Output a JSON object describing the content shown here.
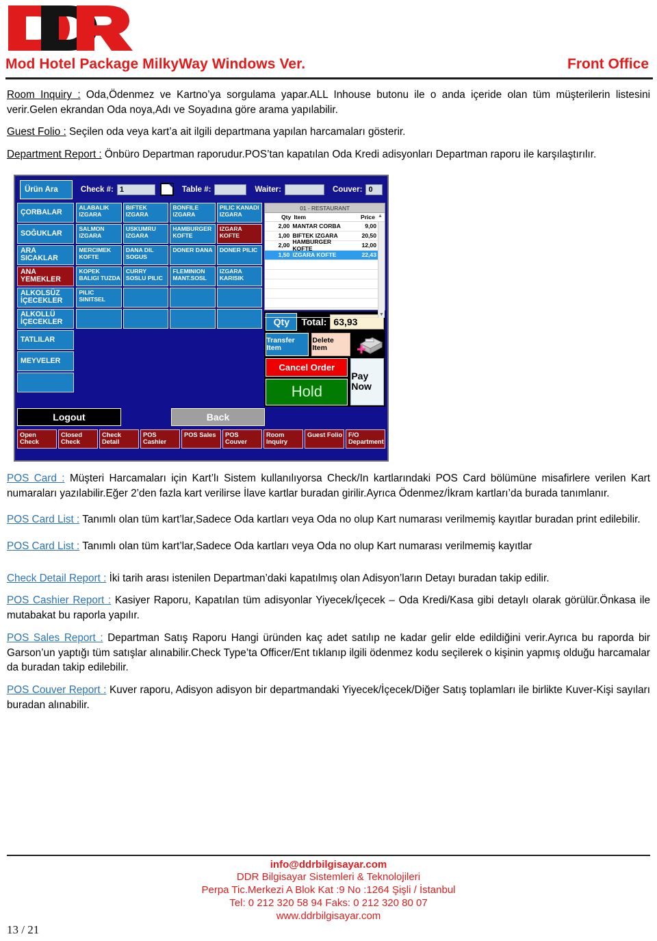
{
  "header": {
    "logo_text": "DDR",
    "title_left": "Mod Hotel Package MilkyWay Windows Ver.",
    "title_right": "Front Office"
  },
  "sections": [
    {
      "label": "Room Inquiry :",
      "label_color": "black",
      "body": "Oda,Ödenmez ve Kartno’ya sorgulama yapar.ALL Inhouse butonu ile o anda içeride olan tüm müşterilerin listesini verir.Gelen ekrandan Oda noya,Adı ve Soyadına göre arama yapılabilir."
    },
    {
      "label": "Guest Folio :",
      "label_color": "black",
      "body": "Seçilen oda veya kart’a ait ilgili departmana yapılan harcamaları gösterir."
    },
    {
      "label": "Department Report :",
      "label_color": "black",
      "body": "Önbüro Departman raporudur.POS’tan kapatılan Oda Kredi adisyonları Departman raporu ile karşılaştırılır."
    },
    {
      "label": "POS Card :",
      "label_color": "blue",
      "body": "Müşteri Harcamaları için Kart’lı Sistem kullanılıyorsa Check/In kartlarındaki POS Card bölümüne misafirlere verilen Kart numaraları yazılabilir.Eğer 2’den fazla kart verilirse İlave kartlar buradan girilir.Ayrıca Ödenmez/İkram kartları’da burada tanımlanır."
    },
    {
      "label": "POS Card List :",
      "label_color": "blue",
      "body": "Tanımlı olan tüm kart’lar,Sadece Oda kartları veya Oda no olup Kart numarası verilmemiş kayıtlar buradan print edilebilir."
    },
    {
      "label": "POS Card List :",
      "label_color": "blue",
      "body": "Tanımlı olan tüm kart’lar,Sadece Oda kartları veya Oda no olup Kart numarası verilmemiş kayıtlar"
    },
    {
      "label": "Check Detail Report :",
      "label_color": "blue",
      "body": "İki tarih arası istenilen Departman’daki kapatılmış olan Adisyon’ların Detayı buradan takip edilir."
    },
    {
      "label": "POS Cashier Report :",
      "label_color": "blue",
      "body": "Kasiyer Raporu, Kapatılan tüm adisyonlar Yiyecek/İçecek – Oda Kredi/Kasa gibi detaylı olarak görülür.Önkasa ile mutabakat bu raporla yapılır."
    },
    {
      "label": "POS Sales Report :",
      "label_color": "blue",
      "body": "Departman Satış Raporu Hangi üründen kaç adet satılıp ne kadar gelir elde edildiğini verir.Ayrıca bu raporda bir Garson’un yaptığı tüm satışlar alınabilir.Check Type’ta Officer/Ent tıklanıp ilgili ödenmez kodu seçilerek o kişinin yapmış olduğu harcamalar da buradan takip edilebilir."
    },
    {
      "label": "POS Couver Report :",
      "label_color": "blue",
      "body": "Kuver raporu, Adisyon adisyon bir departmandaki Yiyecek/İçecek/Diğer Satış toplamları ile birlikte Kuver-Kişi sayıları buradan alınabilir."
    }
  ],
  "pos": {
    "search_button": "Ürün Ara",
    "fields": [
      {
        "label": "Check #:",
        "value": "1"
      },
      {
        "label": "Table #:",
        "value": ""
      },
      {
        "label": "Waiter:",
        "value": ""
      },
      {
        "label": "Couver:",
        "value": "0"
      }
    ],
    "categories": [
      {
        "label": "ÇORBALAR",
        "selected": false
      },
      {
        "label": "SOĞUKLAR",
        "selected": false
      },
      {
        "label": "ARA SICAKLAR",
        "selected": false
      },
      {
        "label": "ANA YEMEKLER",
        "selected": true
      },
      {
        "label": "ALKOLSÜZ İÇECEKLER",
        "selected": false
      },
      {
        "label": "ALKOLLÜ İÇECEKLER",
        "selected": false
      },
      {
        "label": "TATLILAR",
        "selected": false
      },
      {
        "label": "MEYVELER",
        "selected": false
      },
      {
        "label": "",
        "selected": false
      }
    ],
    "products": [
      {
        "label": "ALABALIK IZGARA",
        "selected": false
      },
      {
        "label": "BIFTEK IZGARA",
        "selected": false
      },
      {
        "label": "BONFILE IZGARA",
        "selected": false
      },
      {
        "label": "PILIC KANADI IZGARA",
        "selected": false
      },
      {
        "label": "SALMON IZGARA",
        "selected": false
      },
      {
        "label": "USKUMRU IZGARA",
        "selected": false
      },
      {
        "label": "HAMBURGER KOFTE",
        "selected": false
      },
      {
        "label": "IZGARA KOFTE",
        "selected": true
      },
      {
        "label": "MERCIMEK KOFTE",
        "selected": false
      },
      {
        "label": "DANA DIL SOGUS",
        "selected": false
      },
      {
        "label": "DONER DANA",
        "selected": false
      },
      {
        "label": "DONER PILIC",
        "selected": false
      },
      {
        "label": "KOPEK BALIGI TUZDA",
        "selected": false
      },
      {
        "label": "CURRY SOSLU PILIC",
        "selected": false
      },
      {
        "label": "FLEMINION MANT.SOSL",
        "selected": false
      },
      {
        "label": "IZGARA KARISIK",
        "selected": false
      },
      {
        "label": "PILIC SINITSEL",
        "selected": false
      },
      {
        "label": "",
        "selected": false
      },
      {
        "label": "",
        "selected": false
      },
      {
        "label": "",
        "selected": false
      },
      {
        "label": "",
        "selected": false
      },
      {
        "label": "",
        "selected": false
      },
      {
        "label": "",
        "selected": false
      },
      {
        "label": "",
        "selected": false
      }
    ],
    "order": {
      "title": "01 - RESTAURANT",
      "columns": {
        "qty": "Qty",
        "item": "Item",
        "price": "Price"
      },
      "rows": [
        {
          "qty": "2,00",
          "item": "MANTAR CORBA",
          "price": "9,00",
          "selected": false
        },
        {
          "qty": "1,00",
          "item": "BIFTEK IZGARA",
          "price": "20,50",
          "selected": false
        },
        {
          "qty": "2,00",
          "item": "HAMBURGER KOFTE",
          "price": "12,00",
          "selected": false
        },
        {
          "qty": "1,50",
          "item": "IZGARA KOFTE",
          "price": "22,43",
          "selected": true
        }
      ]
    },
    "controls": {
      "qty_button": "Qty",
      "total_label": "Total:",
      "total_value": "63,93",
      "transfer_item": "Transfer Item",
      "delete_item": "Delete Item",
      "cancel_order": "Cancel Order",
      "hold": "Hold",
      "pay_now": "Pay Now",
      "logout": "Logout",
      "back": "Back"
    },
    "bottom_buttons": [
      "Open Check",
      "Closed Check",
      "Check Detail",
      "POS Cashier",
      "POS Sales",
      "POS Couver",
      "Room Inquiry",
      "Guest Folio",
      "F/O Department"
    ]
  },
  "footer": {
    "email": "info@ddrbilgisayar.com",
    "company": "DDR Bilgisayar Sistemleri & Teknolojileri",
    "address": "Perpa Tic.Merkezi A Blok Kat :9 No :1264    Şişli / İstanbul",
    "phone": "Tel: 0 212 320 58 94   Faks: 0 212 320 80 07",
    "web": "www.ddrbilgisayar.com",
    "page": "13 / 21"
  }
}
